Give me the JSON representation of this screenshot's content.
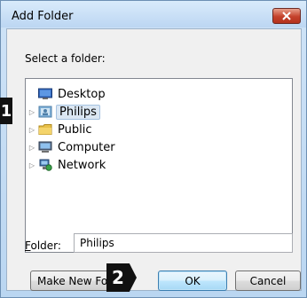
{
  "window": {
    "title": "Add Folder"
  },
  "prompt": "Select a folder:",
  "tree": [
    {
      "label": "Desktop",
      "icon": "desktop-icon",
      "expander": false,
      "selected": false
    },
    {
      "label": "Philips",
      "icon": "user-folder-icon",
      "expander": true,
      "selected": true
    },
    {
      "label": "Public",
      "icon": "folder-icon",
      "expander": true,
      "selected": false
    },
    {
      "label": "Computer",
      "icon": "computer-icon",
      "expander": true,
      "selected": false
    },
    {
      "label": "Network",
      "icon": "network-icon",
      "expander": true,
      "selected": false
    }
  ],
  "folder": {
    "label_accel": "F",
    "label_rest": "older:",
    "value": "Philips"
  },
  "buttons": {
    "new_folder": "Make New Folder",
    "ok": "OK",
    "cancel": "Cancel"
  },
  "markers": {
    "m1": "1",
    "m2": "2"
  },
  "colors": {
    "close_button": "#c4412b",
    "selection": "#dbe7f3",
    "marker": "#111111"
  }
}
